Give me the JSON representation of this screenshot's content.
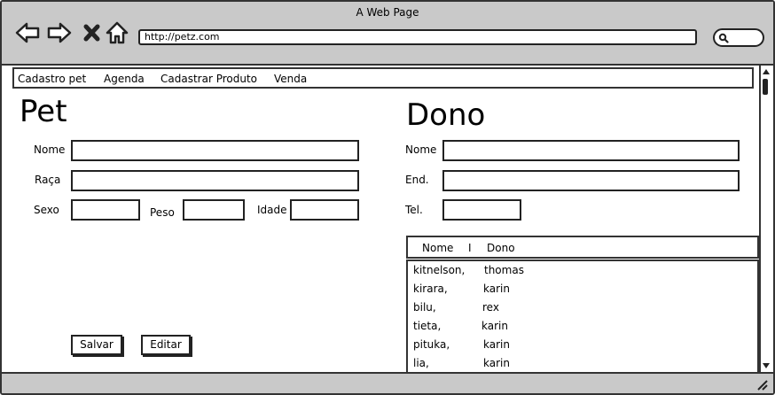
{
  "browser": {
    "title": "A Web Page",
    "url": "http://petz.com"
  },
  "menu": {
    "items": [
      "Cadastro pet",
      "Agenda",
      "Cadastrar Produto",
      "Venda"
    ]
  },
  "pet": {
    "heading": "Pet",
    "nome_label": "Nome",
    "raca_label": "Raça",
    "sexo_label": "Sexo",
    "peso_label": "Peso",
    "idade_label": "Idade",
    "save_label": "Salvar",
    "edit_label": "Editar"
  },
  "dono": {
    "heading": "Dono",
    "nome_label": "Nome",
    "end_label": "End.",
    "tel_label": "Tel.",
    "table": {
      "columns": [
        "Nome",
        "I",
        "Dono"
      ],
      "rows": [
        [
          "kitnelson,",
          "thomas"
        ],
        [
          "kirara,",
          "karin"
        ],
        [
          "bilu,",
          "rex"
        ],
        [
          "tieta,",
          "karin"
        ],
        [
          "pituka,",
          "karin"
        ],
        [
          "lia,",
          "karin"
        ]
      ]
    }
  }
}
